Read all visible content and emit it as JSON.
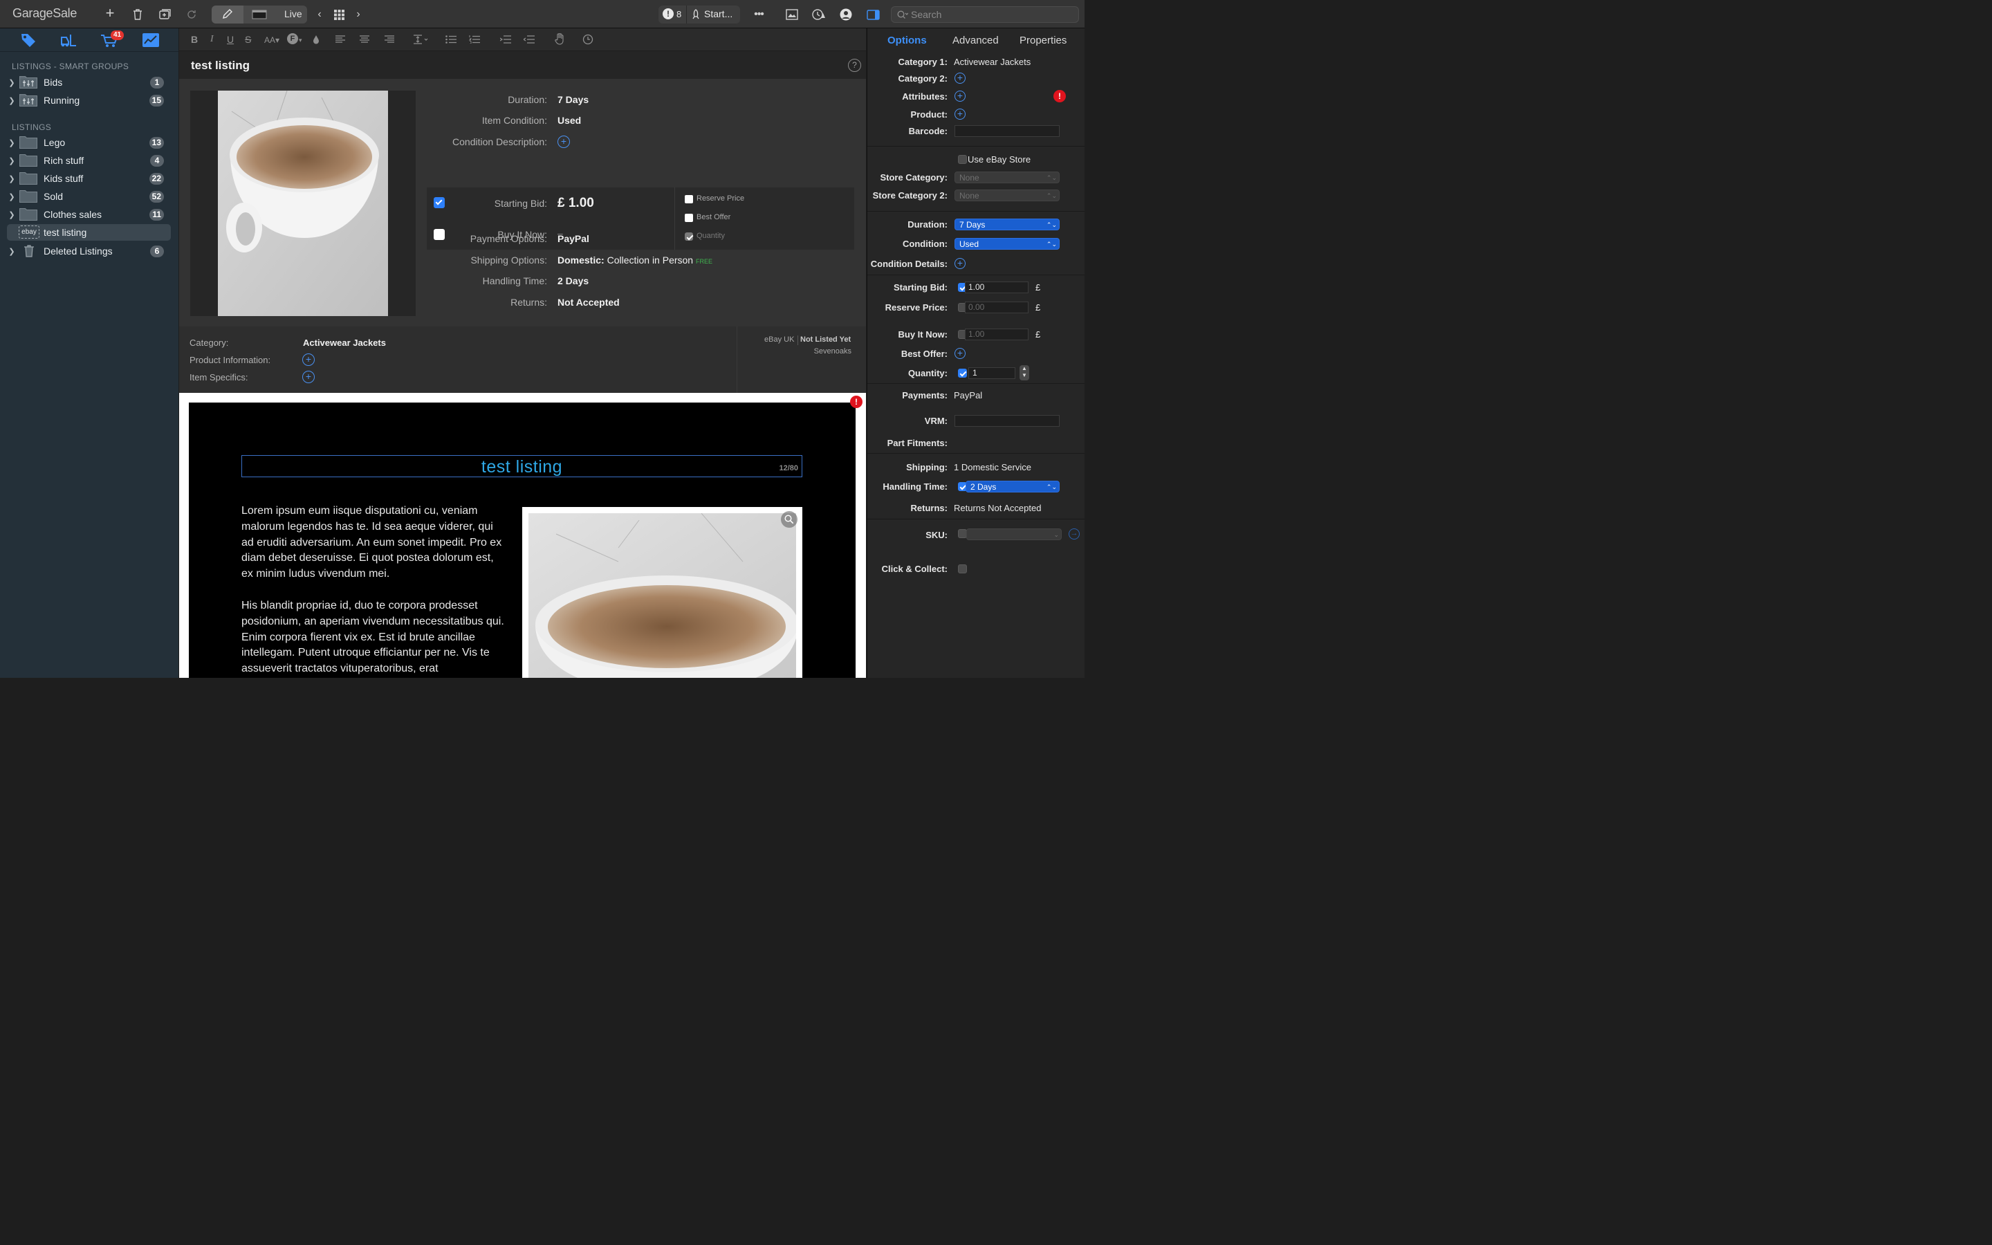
{
  "app": {
    "title": "GarageSale"
  },
  "toolbar": {
    "mode_label": "Live",
    "alerts_count": "8",
    "start_label": "Start...",
    "search_placeholder": "Search"
  },
  "sidebar": {
    "cart_badge": "41",
    "smart_groups_title": "LISTINGS - SMART GROUPS",
    "smart_groups": [
      {
        "label": "Bids",
        "count": "1"
      },
      {
        "label": "Running",
        "count": "15"
      }
    ],
    "listings_title": "LISTINGS",
    "folders": [
      {
        "label": "Lego",
        "count": "13"
      },
      {
        "label": "Rich stuff",
        "count": "4"
      },
      {
        "label": "Kids stuff",
        "count": "22"
      },
      {
        "label": "Sold",
        "count": "52"
      },
      {
        "label": "Clothes sales",
        "count": "11"
      }
    ],
    "selected": {
      "label": "test listing",
      "badge": "ebay"
    },
    "deleted": {
      "label": "Deleted Listings",
      "count": "6"
    }
  },
  "listing": {
    "title": "test listing",
    "duration_label": "Duration:",
    "duration": "7 Days",
    "condition_label": "Item Condition:",
    "condition": "Used",
    "condition_desc_label": "Condition Description:",
    "starting_bid_label": "Starting Bid:",
    "starting_bid": "£ 1.00",
    "buy_it_now_label": "Buy It Now:",
    "buy_it_now": "–",
    "reserve_label": "Reserve Price",
    "best_offer_label": "Best Offer",
    "quantity_label": "Quantity",
    "payment_label": "Payment Options:",
    "payment": "PayPal",
    "shipping_label": "Shipping Options:",
    "shipping_bold": "Domestic:",
    "shipping": "Collection in Person",
    "shipping_free": "FREE",
    "handling_label": "Handling Time:",
    "handling": "2 Days",
    "returns_label": "Returns:",
    "returns": "Not Accepted",
    "category_label": "Category:",
    "category": "Activewear Jackets",
    "product_info_label": "Product Information:",
    "item_specifics_label": "Item Specifics:",
    "site": "eBay UK",
    "status": "Not Listed Yet",
    "location": "Sevenoaks"
  },
  "preview": {
    "title": "test listing",
    "char_count": "12/80",
    "para1": "Lorem ipsum eum iisque disputationi cu, veniam malorum legendos has te. Id sea aeque viderer, qui ad eruditi adversarium. An eum sonet impedit. Pro ex diam debet deseruisse. Ei quot postea dolorum est, ex minim ludus vivendum mei.",
    "para2": "His blandit propriae id, duo te corpora prodesset posidonium, an aperiam vivendum necessitatibus qui. Enim corpora fierent vix ex. Est id brute ancillae intellegam. Putent utroque efficiantur per ne. Vis te assueverit tractatos vituperatoribus, erat"
  },
  "panel": {
    "tabs": [
      "Options",
      "Advanced",
      "Properties"
    ],
    "category1_label": "Category 1:",
    "category1": "Activewear Jackets",
    "category2_label": "Category 2:",
    "attributes_label": "Attributes:",
    "product_label": "Product:",
    "barcode_label": "Barcode:",
    "use_ebay_store": "Use eBay Store",
    "store_cat_label": "Store Category:",
    "store_cat": "None",
    "store_cat2_label": "Store Category 2:",
    "store_cat2": "None",
    "duration_label": "Duration:",
    "duration": "7 Days",
    "condition_label": "Condition:",
    "condition": "Used",
    "condition_details_label": "Condition Details:",
    "starting_bid_label": "Starting Bid:",
    "starting_bid": "1.00",
    "reserve_label": "Reserve Price:",
    "reserve": "0.00",
    "bin_label": "Buy It Now:",
    "bin": "1.00",
    "best_offer_label": "Best Offer:",
    "quantity_label": "Quantity:",
    "quantity": "1",
    "currency": "£",
    "payments_label": "Payments:",
    "payments": "PayPal",
    "vrm_label": "VRM:",
    "part_fitments_label": "Part Fitments:",
    "shipping_label": "Shipping:",
    "shipping": "1 Domestic Service",
    "handling_label": "Handling Time:",
    "handling": "2 Days",
    "returns_label": "Returns:",
    "returns": "Returns Not Accepted",
    "sku_label": "SKU:",
    "click_collect_label": "Click & Collect:"
  }
}
